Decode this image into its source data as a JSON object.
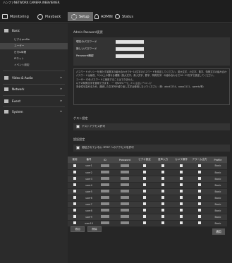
{
  "app": {
    "title": "ハンファNETWORK CAMERA WEBVIEWER"
  },
  "topnav": {
    "tabs": [
      {
        "label": "Monitoring",
        "icon": "monitor-icon"
      },
      {
        "label": "Playback",
        "icon": "playback-icon"
      },
      {
        "label": "Setup",
        "icon": "gear-icon",
        "active": true
      },
      {
        "label": "ADMIN",
        "icon": "person-icon"
      },
      {
        "label": "Status",
        "icon": "info-icon"
      }
    ]
  },
  "sidebar": {
    "basic": {
      "label": "Basic",
      "items": [
        "ビデオprofile",
        "ユーザー",
        "日付&時間",
        "IPネット",
        "イベント設定"
      ]
    },
    "sections": [
      {
        "label": "Video & Audio"
      },
      {
        "label": "Network"
      },
      {
        "label": "Event"
      },
      {
        "label": "System"
      }
    ]
  },
  "main": {
    "admin_section": {
      "title": "Admin Password変更",
      "rows": [
        {
          "label": "現在のパスワード"
        },
        {
          "label": "新しいパスワード"
        },
        {
          "label": "Password確認"
        }
      ]
    },
    "note_lines": [
      "パスワードポリシーを満たす英数字の組み合わせで8~10文字のパスワードを設定してください。英大文字、小文字、数字、特殊文字の組み合わせで入力します。",
      "パスワードは最低、3つ以上の異なる種類（英大文字、英小文字、数字、特殊文字）の組み合わせで10~15文字で設定してください。",
      "ユーザー IDをパスワードに使用することはできません。",
      "以下の特殊文字を使用できます。 ~`!@#$%^*()_-+={}[]|\\;:'\"<>.,?/",
      "安全性を高めるため、連続した文字列や繰り返し文字は使用しないでください（例：abcd1234、aaaa1111、qwerty等）"
    ],
    "guest_section": {
      "title": "ゲスト設定",
      "checkbox_label": "ゲストアクセス許可"
    },
    "auth_section": {
      "title": "認証設定",
      "checkbox_label": "認証されていない RTSP へのアクセスを許可"
    },
    "users_section": {
      "title": "現在のユーザー",
      "columns": [
        "使用",
        "番号",
        "ID",
        "Password",
        "ビデオ設定",
        "音声入力",
        "カメラ操作",
        "アラーム出力",
        "Profile"
      ],
      "rows": [
        {
          "num": "user1",
          "profile": "Basic"
        },
        {
          "num": "user2",
          "profile": "Basic"
        },
        {
          "num": "user3",
          "profile": "Basic"
        },
        {
          "num": "user4",
          "profile": "Basic"
        },
        {
          "num": "user5",
          "profile": "Basic"
        },
        {
          "num": "user6",
          "profile": "Basic"
        },
        {
          "num": "user7",
          "profile": "Basic"
        },
        {
          "num": "user8",
          "profile": "Basic"
        },
        {
          "num": "user9",
          "profile": "Basic"
        },
        {
          "num": "user10",
          "profile": "Basic"
        }
      ]
    },
    "buttons": {
      "add": "追加",
      "delete": "削除",
      "apply": "適用"
    }
  }
}
